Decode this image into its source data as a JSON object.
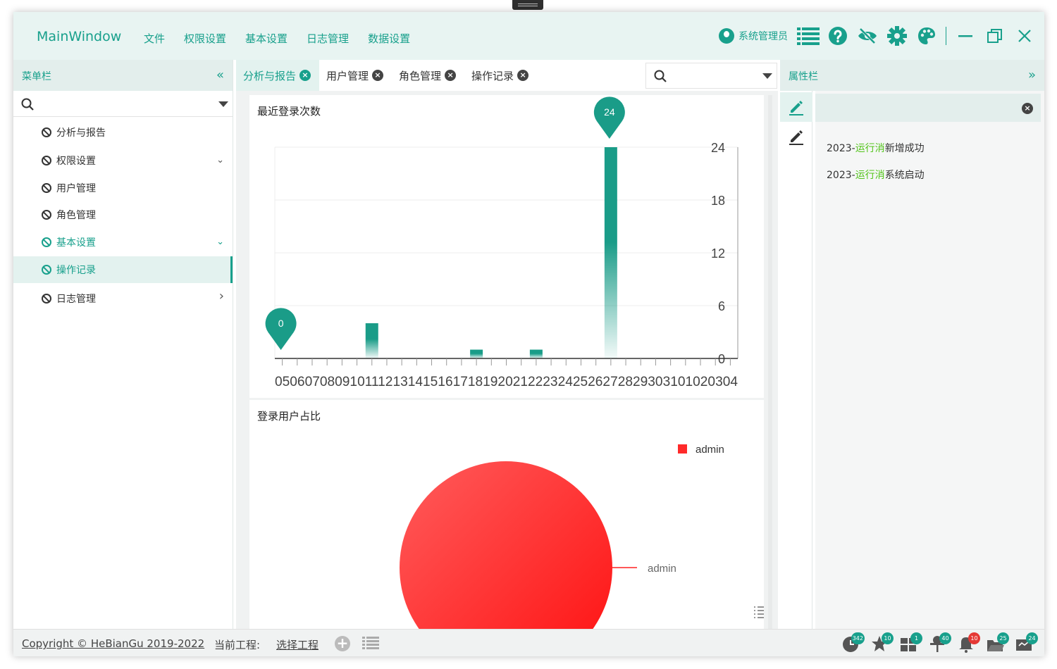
{
  "app": {
    "title": "MainWindow"
  },
  "menu": [
    "文件",
    "权限设置",
    "基本设置",
    "日志管理",
    "数据设置"
  ],
  "header": {
    "user": "系统管理员"
  },
  "left_panel": {
    "title": "菜单栏",
    "collapse": "«",
    "items": [
      {
        "label": "分析与报告",
        "arrow": ""
      },
      {
        "label": "权限设置",
        "arrow": "⌄"
      },
      {
        "label": "用户管理",
        "arrow": ""
      },
      {
        "label": "角色管理",
        "arrow": ""
      },
      {
        "label": "基本设置",
        "arrow": "⌄"
      },
      {
        "label": "操作记录",
        "arrow": ""
      },
      {
        "label": "日志管理",
        "arrow": "›"
      }
    ]
  },
  "tabs": [
    {
      "label": "分析与报告"
    },
    {
      "label": "用户管理"
    },
    {
      "label": "角色管理"
    },
    {
      "label": "操作记录"
    }
  ],
  "close_glyph": "×",
  "right_panel": {
    "title": "属性栏",
    "expand": "»",
    "logs": [
      {
        "prefix": "2023-",
        "highlight": "运行消",
        "suffix": "新增成功"
      },
      {
        "prefix": "2023-",
        "highlight": "运行消",
        "suffix": "系统启动"
      }
    ]
  },
  "status": {
    "copyright": "Copyright © HeBianGu 2019-2022",
    "project_label": "当前工程:",
    "select_project": "选择工程",
    "plus": "+",
    "badges": [
      {
        "icon": "clock-icon",
        "count": "342",
        "color": "#18a08c"
      },
      {
        "icon": "star-icon",
        "count": "10",
        "color": "#18a08c"
      },
      {
        "icon": "apps-icon",
        "count": "1",
        "color": "#18a08c"
      },
      {
        "icon": "pin-icon",
        "count": "40",
        "color": "#18a08c"
      },
      {
        "icon": "bell-icon",
        "count": "10",
        "color": "#e53935"
      },
      {
        "icon": "folder-icon",
        "count": "25",
        "color": "#18a08c"
      },
      {
        "icon": "message-icon",
        "count": "24",
        "color": "#18a08c"
      }
    ]
  },
  "chart_data": [
    {
      "type": "bar",
      "title": "最近登录次数",
      "categories": [
        "05",
        "06",
        "07",
        "08",
        "09",
        "10",
        "11",
        "12",
        "13",
        "14",
        "15",
        "16",
        "17",
        "18",
        "19",
        "20",
        "21",
        "22",
        "23",
        "24",
        "25",
        "26",
        "27",
        "28",
        "29",
        "30",
        "31",
        "01",
        "02",
        "03",
        "04"
      ],
      "tick_text": "050607080910111213141516171819202122232425262728293031010203 04",
      "values": [
        0,
        0,
        0,
        0,
        0,
        0,
        4,
        0,
        0,
        0,
        0,
        0,
        0,
        1,
        0,
        0,
        0,
        1,
        0,
        0,
        0,
        0,
        24,
        0,
        0,
        0,
        0,
        0,
        0,
        0,
        0
      ],
      "yticks": [
        0,
        6,
        12,
        18,
        24
      ],
      "ylim": [
        0,
        24
      ],
      "markers": [
        {
          "label": "0",
          "index": 0,
          "value": 0
        },
        {
          "label": "24",
          "index": 22,
          "value": 24
        }
      ],
      "grid": true,
      "color": "#1a9c88"
    },
    {
      "type": "pie",
      "title": "登录用户占比",
      "slices": [
        {
          "name": "admin",
          "value": 1
        }
      ],
      "legend": "top-right",
      "color": "#ff2a2a"
    }
  ]
}
